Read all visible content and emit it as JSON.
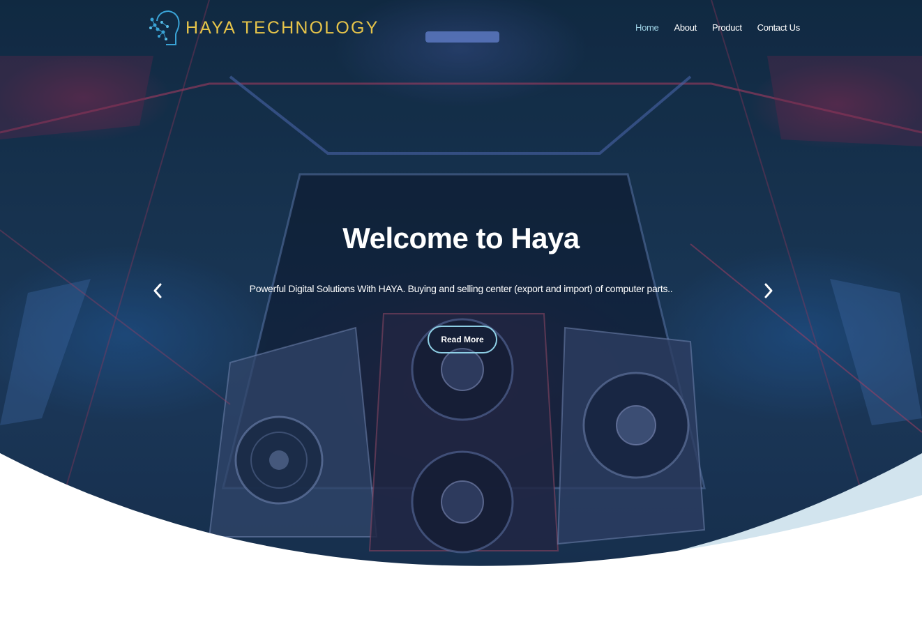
{
  "brand": {
    "name": "HAYA TECHNOLOGY",
    "logo_icon": "circuit-head-icon",
    "accent_color": "#e6c44a"
  },
  "nav": {
    "items": [
      {
        "label": "Home",
        "active": true
      },
      {
        "label": "About",
        "active": false
      },
      {
        "label": "Product",
        "active": false
      },
      {
        "label": "Contact Us",
        "active": false
      }
    ],
    "active_color": "#9fd3e6"
  },
  "hero": {
    "title": "Welcome to Haya",
    "subtitle": "Powerful Digital Solutions With HAYA. Buying and selling center (export and import) of computer parts..",
    "cta_label": "Read More",
    "prev_icon": "chevron-left-icon",
    "next_icon": "chevron-right-icon",
    "button_border_color": "#8fd0e6",
    "curve_color": "#d2e4ee"
  }
}
